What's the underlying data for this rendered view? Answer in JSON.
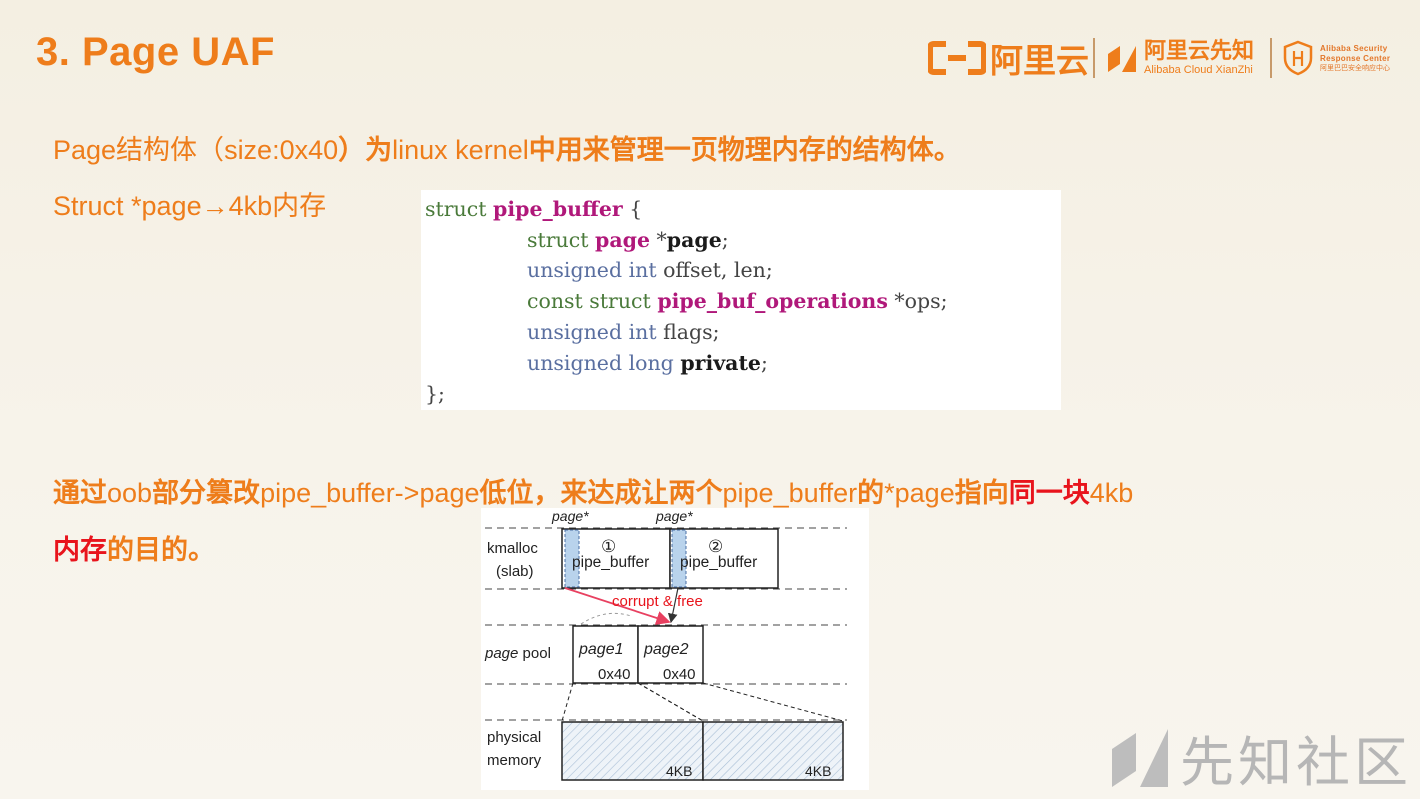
{
  "slide": {
    "title": "3. Page UAF"
  },
  "logos": {
    "aliyun": "阿里云",
    "xianzhi_cn": "阿里云先知",
    "xianzhi_en": "Alibaba Cloud XianZhi",
    "asrc_en1": "Alibaba Security",
    "asrc_en2": "Response Center",
    "asrc_cn": "阿里巴巴安全响应中心"
  },
  "intro": {
    "part1": "Page结构体（",
    "part2": "size:0x40",
    "part3": "）为",
    "part4": "linux kernel",
    "part5": "中用来管理一页物理内存的结构体。",
    "struct_line": "Struct *page→4kb内存"
  },
  "code": {
    "l1_kw": "struct",
    "l1_id": "pipe_buffer",
    "l1_end": " {",
    "l2_kw": "struct",
    "l2_id": "page",
    "l2_star": " *",
    "l2_bd": "page",
    "l2_end": ";",
    "l3_ty": "unsigned int",
    "l3_rest": " offset, len;",
    "l4_kw": "const struct",
    "l4_id": "pipe_buf_operations",
    "l4_rest": " *ops;",
    "l5_ty": "unsigned int",
    "l5_rest": " flags;",
    "l6_ty": "unsigned long",
    "l6_bd": "private",
    "l6_end": ";",
    "l7": "};"
  },
  "para": {
    "a": "通过",
    "b": "oob",
    "c": "部分篡改",
    "d": "pipe_buffer->page",
    "e": "低位，来达成让两个",
    "f": "pipe_buffer",
    "g": "的",
    "h": "*page",
    "i": "指向",
    "j": "同一块",
    "k": "4kb",
    "l": "内存",
    "m": "的目的。"
  },
  "diagram": {
    "page_ptr_label": "page*",
    "kmalloc_1": "kmalloc",
    "kmalloc_2": "(slab)",
    "buf1_num": "①",
    "buf2_num": "②",
    "buf_label": "pipe_buffer",
    "corrupt": "corrupt & free",
    "page_pool_1": "page",
    "page_pool_2": " pool",
    "page1": "page1",
    "page2": "page2",
    "size": "0x40",
    "phys_1": "physical",
    "phys_2": "memory",
    "mem_size": "4KB"
  },
  "watermark": {
    "text": "先知社区"
  },
  "colors": {
    "accent": "#ee7d1b",
    "highlight": "#e8141c",
    "code_keyword": "#4a7a3a",
    "code_type": "#5a6fa0",
    "code_ident": "#b0187a",
    "arrow_red": "#e84060",
    "slab_fill": "#b9d3ec"
  }
}
